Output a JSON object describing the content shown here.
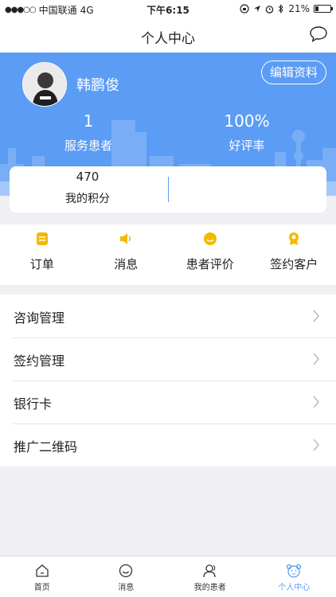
{
  "status_bar": {
    "carrier": "中国联通",
    "network": "4G",
    "time": "下午6:15",
    "battery": "21%",
    "battery_level": 0.21
  },
  "nav": {
    "title": "个人中心",
    "chat_icon": "message-bubble-icon"
  },
  "profile": {
    "username": "韩鹏俊",
    "edit_label": "编辑资料",
    "stats": [
      {
        "value": "1",
        "label": "服务患者"
      },
      {
        "value": "100%",
        "label": "好评率"
      }
    ],
    "points": {
      "value": "470",
      "label": "我的积分"
    }
  },
  "quick_actions": [
    {
      "label": "订单",
      "icon": "order-icon"
    },
    {
      "label": "消息",
      "icon": "speaker-icon"
    },
    {
      "label": "患者评价",
      "icon": "review-icon"
    },
    {
      "label": "签约客户",
      "icon": "medal-icon"
    }
  ],
  "menu": [
    {
      "label": "咨询管理"
    },
    {
      "label": "签约管理"
    },
    {
      "label": "银行卡"
    },
    {
      "label": "推广二维码"
    }
  ],
  "tabs": [
    {
      "label": "首页",
      "icon": "home-icon"
    },
    {
      "label": "消息",
      "icon": "smile-icon"
    },
    {
      "label": "我的患者",
      "icon": "patients-icon"
    },
    {
      "label": "个人中心",
      "icon": "bear-icon",
      "active": true
    }
  ],
  "colors": {
    "accent": "#5b9cf5",
    "icon_yellow": "#f5b800"
  }
}
